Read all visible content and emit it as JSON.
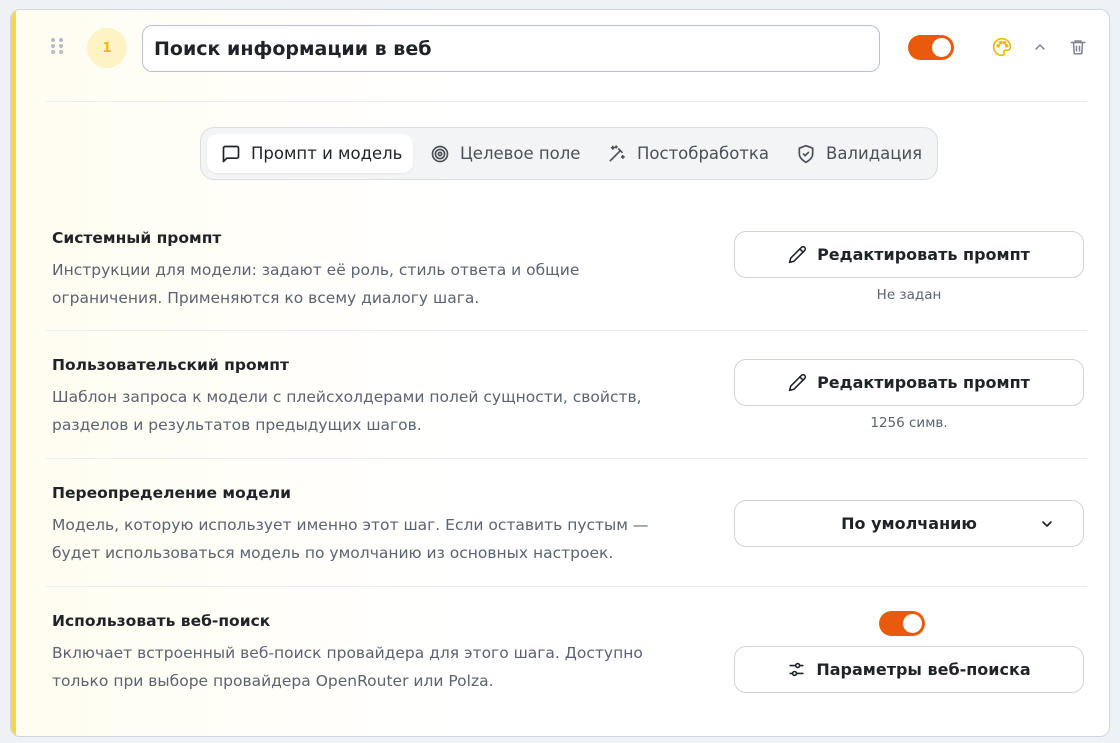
{
  "step": {
    "number": "1",
    "title": "Поиск информации в веб",
    "enabled": true
  },
  "tabs": [
    {
      "label": "Промпт и модель",
      "icon": "message-square-icon",
      "active": true
    },
    {
      "label": "Целевое поле",
      "icon": "target-icon",
      "active": false
    },
    {
      "label": "Постобработка",
      "icon": "magic-wand-icon",
      "active": false
    },
    {
      "label": "Валидация",
      "icon": "shield-check-icon",
      "active": false
    }
  ],
  "system_prompt": {
    "title": "Системный промпт",
    "description": "Инструкции для модели: задают её роль, стиль ответа и общие ограничения. Применяются ко всему диалогу шага.",
    "button_label": "Редактировать промпт",
    "status": "Не задан"
  },
  "user_prompt": {
    "title": "Пользовательский промпт",
    "description": "Шаблон запроса к модели с плейсхолдерами полей сущности, свойств, разделов и результатов предыдущих шагов.",
    "button_label": "Редактировать промпт",
    "status": "1256 симв."
  },
  "model_override": {
    "title": "Переопределение модели",
    "description": "Модель, которую использует именно этот шаг. Если оставить пустым — будет использоваться модель по умолчанию из основных настроек.",
    "selected": "По умолчанию"
  },
  "web_search": {
    "title": "Использовать веб-поиск",
    "description": "Включает встроенный веб-поиск провайдера для этого шага. Доступно только при выборе провайдера OpenRouter или Polza.",
    "enabled": true,
    "button_label": "Параметры веб-поиска"
  },
  "colors": {
    "accent": "#ea5a0c",
    "stripe": "#f5d84a",
    "badge_bg": "#fdf3c4",
    "badge_text": "#f0b815"
  }
}
